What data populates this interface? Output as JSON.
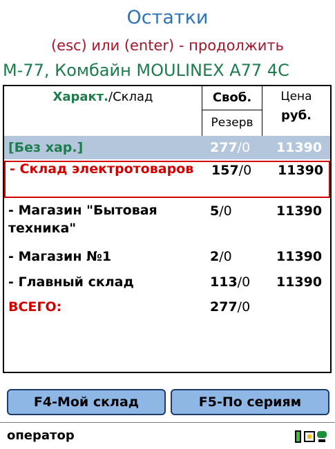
{
  "header": {
    "title": "Остатки",
    "subtitle": "(esc) или (enter) - продолжить",
    "item": "М-77, Комбайн MOULINEX  A77 4C"
  },
  "table": {
    "headers": {
      "char_bold": "Характ.",
      "char_rest": "/Склад",
      "free": "Своб.",
      "reserve": "Резерв",
      "price_top": "Цена",
      "price_bottom": "руб."
    },
    "rows": [
      {
        "name": "[Без хар.]",
        "free": "277",
        "reserve": "/0",
        "price": "11390"
      },
      {
        "name": "- Склад электротоваров",
        "free": "157",
        "reserve": "/0",
        "price": "11390"
      },
      {
        "name": "- Магазин \"Бытовая техника\"",
        "free": "5",
        "reserve": "/0",
        "price": "11390"
      },
      {
        "name": "- Магазин №1",
        "free": "2",
        "reserve": "/0",
        "price": "11390"
      },
      {
        "name": "- Главный склад",
        "free": "113",
        "reserve": "/0",
        "price": "11390"
      },
      {
        "name": "ВСЕГО:",
        "free": "277",
        "reserve": "/0",
        "price": ""
      }
    ]
  },
  "buttons": {
    "f4": "F4-Мой склад",
    "f5": "F5-По сериям"
  },
  "status": {
    "user": "оператор"
  },
  "colors": {
    "title": "#2e74b5",
    "subtitle": "#a5162b",
    "item": "#1c7c4b",
    "highlight": "#d40000",
    "selected_bg": "#b4c6dc"
  },
  "icons": [
    "battery-icon",
    "connection-icon",
    "chat-icon"
  ]
}
